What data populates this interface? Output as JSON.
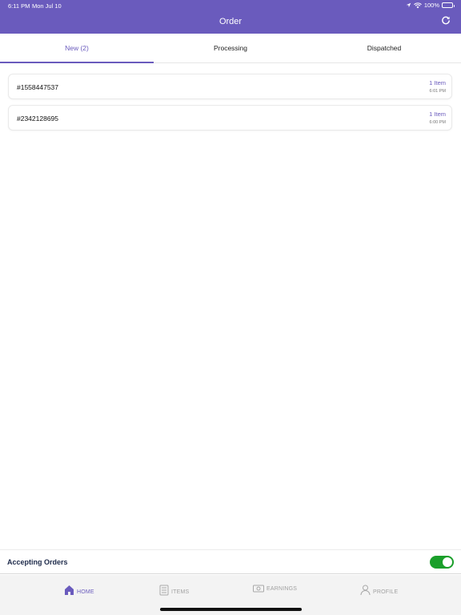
{
  "status_bar": {
    "time": "6:11 PM",
    "date": "Mon Jul 10",
    "battery": "100%"
  },
  "header": {
    "title": "Order",
    "refresh_icon": "refresh-icon"
  },
  "tabs": [
    {
      "label": "New (2)",
      "active": true
    },
    {
      "label": "Processing",
      "active": false
    },
    {
      "label": "Dispatched",
      "active": false
    }
  ],
  "orders": [
    {
      "id": "#1558447537",
      "items": "1 Item",
      "time": "6:01 PM"
    },
    {
      "id": "#2342128695",
      "items": "1 Item",
      "time": "6:00 PM"
    }
  ],
  "accepting": {
    "label": "Accepting Orders",
    "enabled": true
  },
  "tabbar": [
    {
      "label": "HOME",
      "icon": "home-icon",
      "active": true
    },
    {
      "label": "ITEMS",
      "icon": "items-icon",
      "active": false
    },
    {
      "label": "EARNINGS",
      "icon": "earnings-icon",
      "active": false
    },
    {
      "label": "PROFILE",
      "icon": "profile-icon",
      "active": false
    }
  ],
  "colors": {
    "accent": "#6a5bbd",
    "toggle_on": "#1a9f2a",
    "tabbar_bg": "#f3f3f3"
  }
}
